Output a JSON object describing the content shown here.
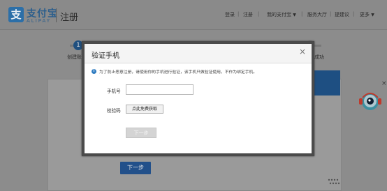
{
  "header": {
    "logo_glyph": "支",
    "logo_name": "支付宝",
    "logo_sub": "ALIPAY",
    "page_title": "注册",
    "nav": {
      "login": "登录",
      "register": "注册",
      "my_alipay": "我的支付宝",
      "service_hall": "服务大厅",
      "feedback": "提建议",
      "more": "更多"
    }
  },
  "steps": {
    "first_number": "1",
    "first_label": "创建账",
    "last_label": "册成功"
  },
  "background": {
    "next_button": "下一步"
  },
  "modal": {
    "title": "验证手机",
    "close": "×",
    "notice": "为了防止恶意注册，请使用你的手机进行验证，该手机只做验证使用，不作为绑定手机。",
    "phone_label": "手机号",
    "phone_value": "",
    "code_label": "校验码",
    "get_code_button": "点此免费获取",
    "next_button": "下一步"
  },
  "colors": {
    "brand": "#2c6fa8",
    "primary_button": "#22508a",
    "info": "#2f7cc1"
  }
}
